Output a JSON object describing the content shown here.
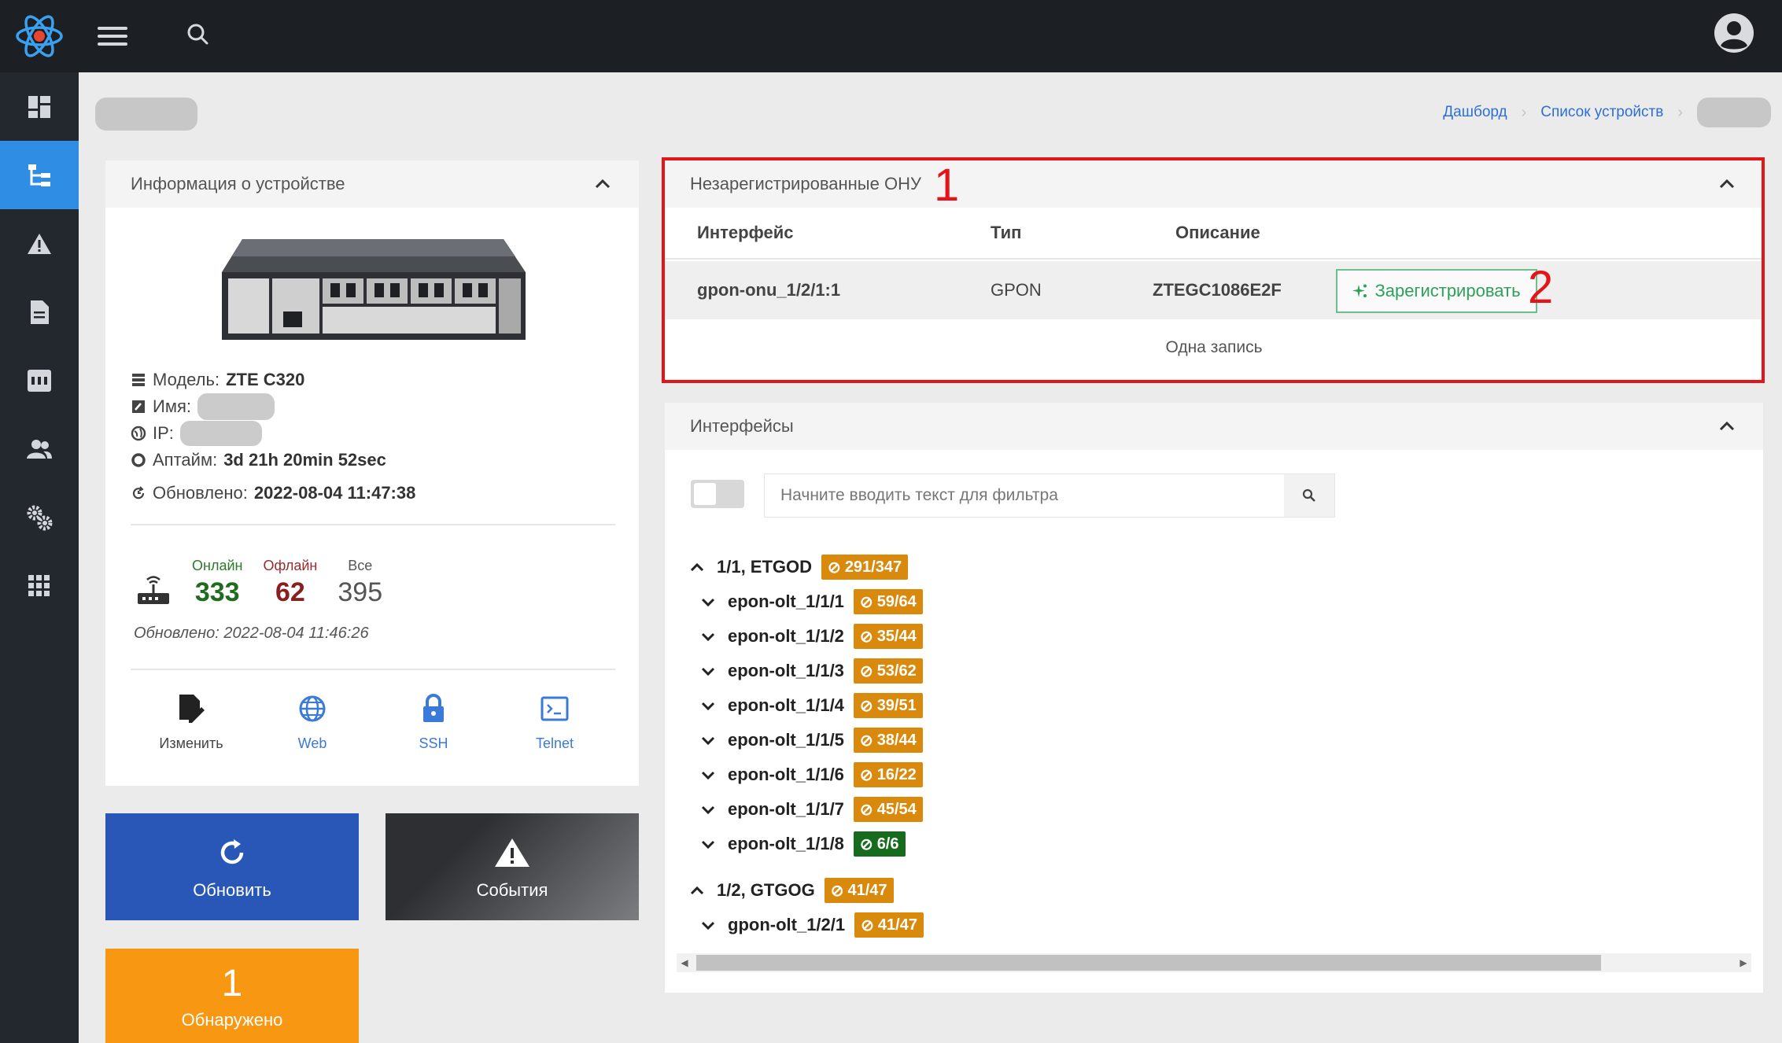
{
  "colors": {
    "topbar": "#1c1f24",
    "sidebar": "#23272e",
    "sidebar_active": "#2f8ee3",
    "refresh_tile": "#2857b8",
    "found_tile": "#f89712",
    "highlight_frame": "#e3151b",
    "badge_orange": "#d9890b",
    "badge_green": "#166b1c"
  },
  "sidebar": {
    "items": [
      {
        "icon": "dashboard-icon",
        "active": false
      },
      {
        "icon": "device-tree-icon",
        "active": true
      },
      {
        "icon": "alert-icon",
        "active": false
      },
      {
        "icon": "document-icon",
        "active": false
      },
      {
        "icon": "switch-icon",
        "active": false
      },
      {
        "icon": "users-icon",
        "active": false
      },
      {
        "icon": "settings-icon",
        "active": false
      },
      {
        "icon": "apps-grid-icon",
        "active": false
      }
    ]
  },
  "breadcrumb": {
    "items": [
      "Дашборд",
      "Список устройств"
    ]
  },
  "device_card": {
    "title": "Информация о устройстве",
    "model_label": "Модель:",
    "model_value": "ZTE C320",
    "name_label": "Имя:",
    "ip_label": "IP:",
    "uptime_label": "Аптайм:",
    "uptime_value": "3d 21h 20min 52sec",
    "updated_label": "Обновлено:",
    "updated_value": "2022-08-04 11:47:38",
    "stats": {
      "online_label": "Онлайн",
      "online_value": "333",
      "offline_label": "Офлайн",
      "offline_value": "62",
      "all_label": "Все",
      "all_value": "395",
      "updated_text": "Обновлено: 2022-08-04 11:46:26"
    },
    "actions": {
      "edit": "Изменить",
      "web": "Web",
      "ssh": "SSH",
      "telnet": "Telnet"
    }
  },
  "tiles": {
    "refresh": "Обновить",
    "events": "События",
    "found_count": "1",
    "found_label": "Обнаружено"
  },
  "onu_card": {
    "title": "Незарегистрированные ОНУ",
    "marker1": "1",
    "marker2": "2",
    "columns": {
      "interface": "Интерфейс",
      "type": "Тип",
      "description": "Описание"
    },
    "row": {
      "interface": "gpon-onu_1/2/1:1",
      "type": "GPON",
      "description": "ZTEGC1086E2F",
      "register_label": "Зарегистрировать"
    },
    "footer": "Одна запись"
  },
  "interfaces_card": {
    "title": "Интерфейсы",
    "filter_placeholder": "Начните вводить текст для фильтра",
    "groups": [
      {
        "name": "1/1, ETGOD",
        "badge": "291/347",
        "children": [
          {
            "name": "epon-olt_1/1/1",
            "badge": "59/64",
            "color": "orange"
          },
          {
            "name": "epon-olt_1/1/2",
            "badge": "35/44",
            "color": "orange"
          },
          {
            "name": "epon-olt_1/1/3",
            "badge": "53/62",
            "color": "orange"
          },
          {
            "name": "epon-olt_1/1/4",
            "badge": "39/51",
            "color": "orange"
          },
          {
            "name": "epon-olt_1/1/5",
            "badge": "38/44",
            "color": "orange"
          },
          {
            "name": "epon-olt_1/1/6",
            "badge": "16/22",
            "color": "orange"
          },
          {
            "name": "epon-olt_1/1/7",
            "badge": "45/54",
            "color": "orange"
          },
          {
            "name": "epon-olt_1/1/8",
            "badge": "6/6",
            "color": "green"
          }
        ]
      },
      {
        "name": "1/2, GTGOG",
        "badge": "41/47",
        "children": [
          {
            "name": "gpon-olt_1/2/1",
            "badge": "41/47",
            "color": "orange"
          }
        ]
      }
    ]
  }
}
